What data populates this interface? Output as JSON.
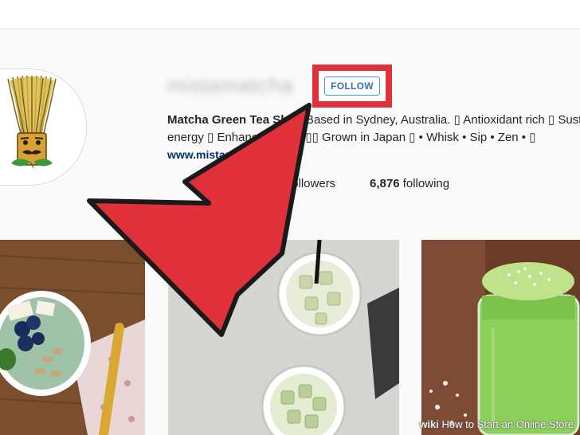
{
  "profile": {
    "username": "mistamatcha",
    "follow_label": "FOLLOW",
    "bio_name": "Matcha Green Tea Shop",
    "bio_line1_rest": " Based in Sydney, Australia. ▯ Antioxidant rich ▯ Sustained",
    "bio_line2": "energy ▯ Enhances focus ▯▯ Grown in Japan ▯ • Whisk • Sip • Zen • ▯",
    "bio_link": "www.mistamatcha.com",
    "followers_label": "followers",
    "following_count": "6,876",
    "following_label": "following"
  },
  "colors": {
    "highlight_red": "#e0303a",
    "follow_blue": "#3a6fb0",
    "text_dark": "#262626"
  },
  "icons": {
    "avatar": "matcha-whisk-character-logo",
    "arrow": "red-pointer-arrow"
  },
  "watermark": {
    "brand": "wiki",
    "title": "How to Start an Online Store"
  }
}
